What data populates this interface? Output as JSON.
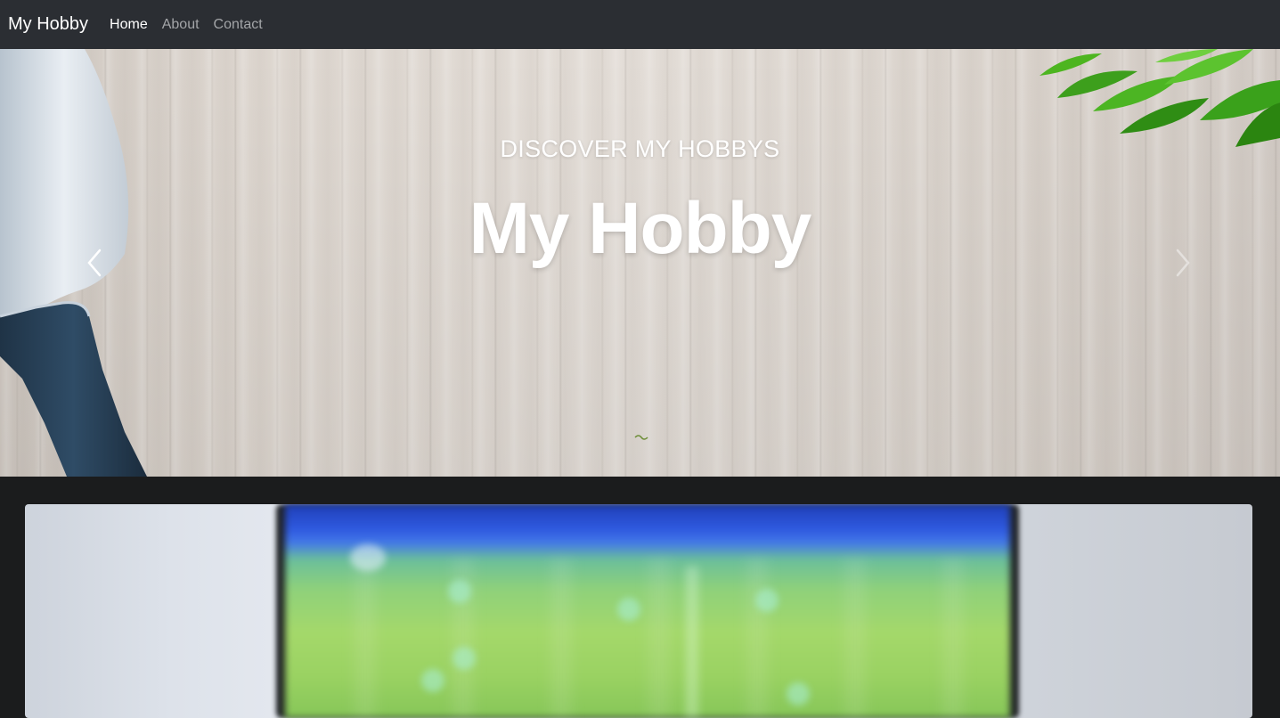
{
  "navbar": {
    "brand": "My Hobby",
    "links": [
      {
        "label": "Home",
        "active": true
      },
      {
        "label": "About",
        "active": false
      },
      {
        "label": "Contact",
        "active": false
      }
    ]
  },
  "hero": {
    "subtitle": "DISCOVER MY HOBBYS",
    "title": "My Hobby",
    "prev_icon": "chevron-left-icon",
    "next_icon": "chevron-right-icon"
  },
  "colors": {
    "navbar_bg": "#2b2e33",
    "page_bg": "#1b1c1d",
    "text_light": "#ffffff",
    "nav_muted": "#a3a5a8"
  }
}
